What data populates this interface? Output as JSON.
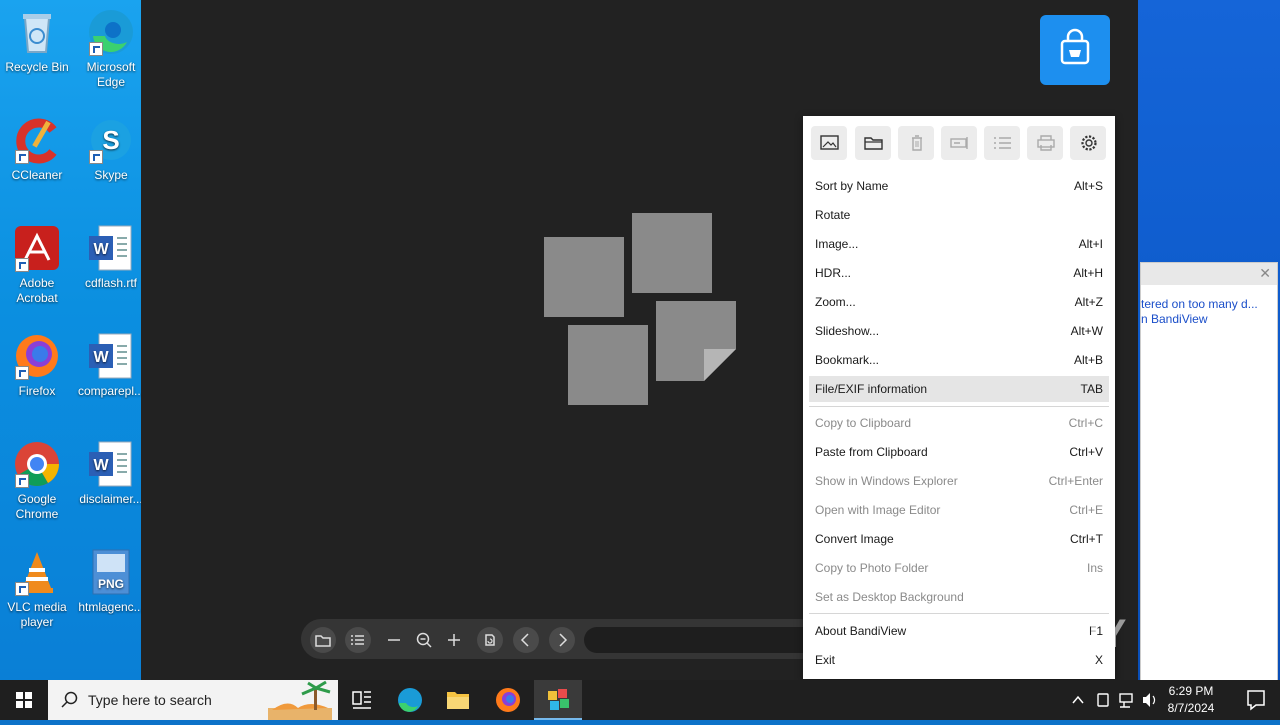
{
  "desktop": {
    "icons": [
      {
        "label": "Recycle Bin"
      },
      {
        "label": "Microsoft Edge"
      },
      {
        "label": "CCleaner"
      },
      {
        "label": "Skype"
      },
      {
        "label": "Adobe Acrobat"
      },
      {
        "label": "cdflash.rtf"
      },
      {
        "label": "Firefox"
      },
      {
        "label": "comparepl..."
      },
      {
        "label": "Google Chrome"
      },
      {
        "label": "disclaimer..."
      },
      {
        "label": "VLC media player"
      },
      {
        "label": "htmlagenc..."
      }
    ]
  },
  "popup": {
    "line1": "tered on too many d...",
    "line2": "n BandiView"
  },
  "menu": {
    "items": [
      {
        "label": "Sort by Name",
        "shortcut": "Alt+S"
      },
      {
        "label": "Rotate",
        "shortcut": ""
      },
      {
        "label": "Image...",
        "shortcut": "Alt+I"
      },
      {
        "label": "HDR...",
        "shortcut": "Alt+H"
      },
      {
        "label": "Zoom...",
        "shortcut": "Alt+Z"
      },
      {
        "label": "Slideshow...",
        "shortcut": "Alt+W"
      },
      {
        "label": "Bookmark...",
        "shortcut": "Alt+B"
      },
      {
        "label": "File/EXIF information",
        "shortcut": "TAB"
      },
      {
        "label": "Copy to Clipboard",
        "shortcut": "Ctrl+C"
      },
      {
        "label": "Paste from Clipboard",
        "shortcut": "Ctrl+V"
      },
      {
        "label": "Show in Windows Explorer",
        "shortcut": "Ctrl+Enter"
      },
      {
        "label": "Open with Image Editor",
        "shortcut": "Ctrl+E"
      },
      {
        "label": "Convert Image",
        "shortcut": "Ctrl+T"
      },
      {
        "label": "Copy to Photo Folder",
        "shortcut": "Ins"
      },
      {
        "label": "Set as Desktop Background",
        "shortcut": ""
      },
      {
        "label": "About BandiView",
        "shortcut": "F1"
      },
      {
        "label": "Exit",
        "shortcut": "X"
      }
    ]
  },
  "watermark": "ANY RUN",
  "taskbar": {
    "search_placeholder": "Type here to search",
    "time": "6:29 PM",
    "date": "8/7/2024"
  },
  "colors": {
    "accent": "#1d8fef",
    "viewer_bg": "#222222",
    "taskbar_bg": "#1f1f1f"
  }
}
